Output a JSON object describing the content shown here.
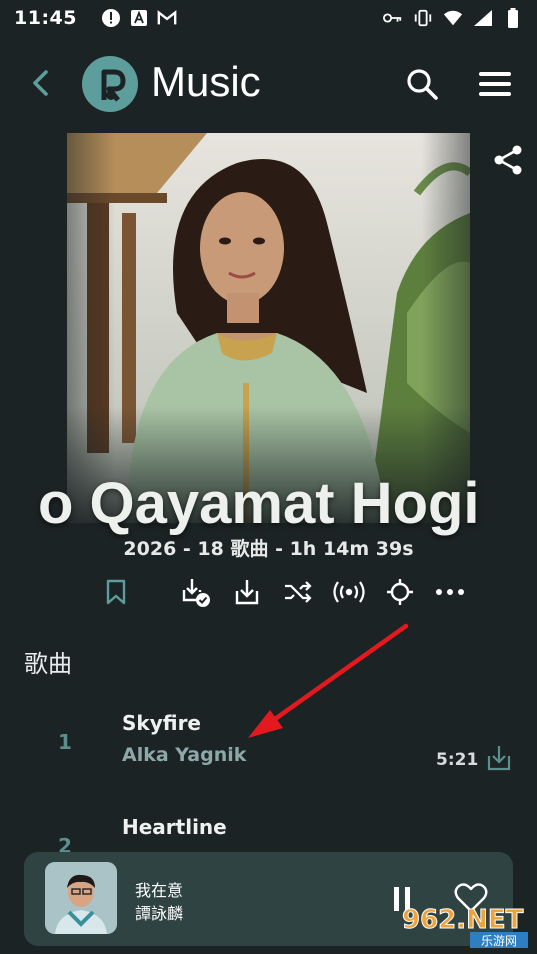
{
  "status_bar": {
    "time": "11:45"
  },
  "header": {
    "brand": "Music"
  },
  "album": {
    "title": "o Qayamat Hogi",
    "meta": "2026 - 18 歌曲 - 1h 14m 39s"
  },
  "section": {
    "songs_heading": "歌曲"
  },
  "tracks": [
    {
      "number": "1",
      "title": "Skyfire",
      "artist": "Alka Yagnik",
      "duration": "5:21"
    },
    {
      "number": "2",
      "title": "Heartline",
      "artist": "",
      "duration": ""
    }
  ],
  "now_playing": {
    "title": "我在意",
    "artist": "譚詠麟"
  },
  "watermark": {
    "brand": "962.NET",
    "sub": "乐游网"
  },
  "colors": {
    "background": "#1c2324",
    "accent": "#5d9d9b",
    "player_bg": "#2f4343"
  },
  "icons": [
    "back-icon",
    "search-icon",
    "menu-icon",
    "share-icon",
    "bookmark-icon",
    "downloaded-icon",
    "download-icon",
    "shuffle-icon",
    "radio-icon",
    "locate-icon",
    "more-icon",
    "pause-icon",
    "heart-icon"
  ]
}
